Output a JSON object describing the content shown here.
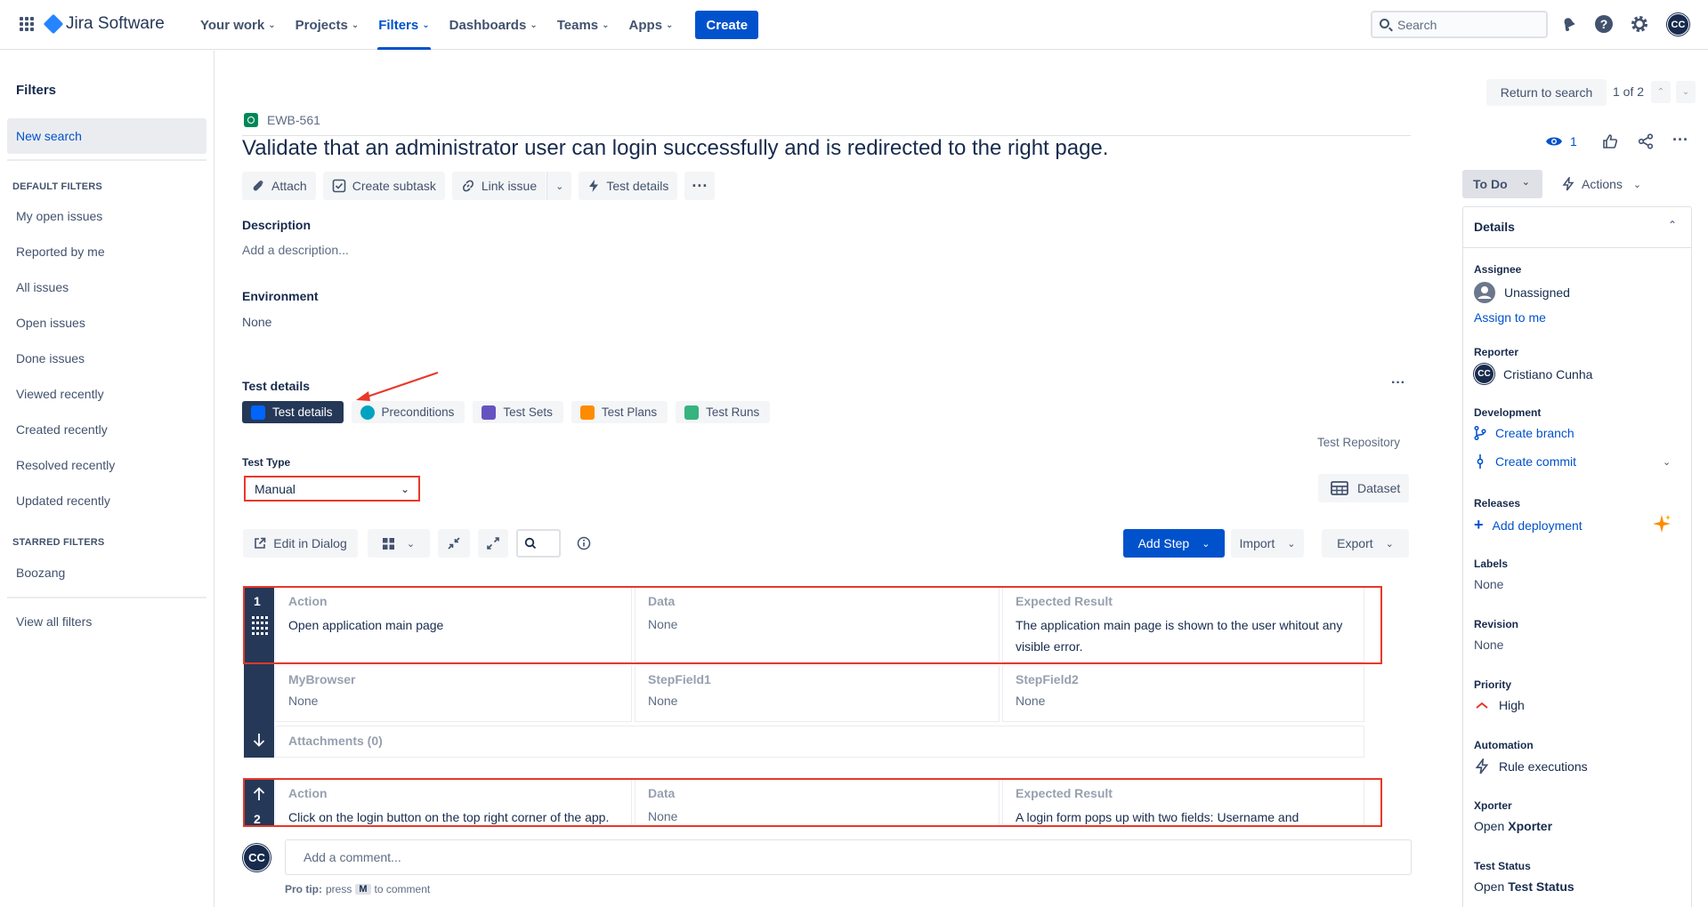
{
  "nav": {
    "product": "Jira Software",
    "items": [
      {
        "label": "Your work"
      },
      {
        "label": "Projects"
      },
      {
        "label": "Filters"
      },
      {
        "label": "Dashboards"
      },
      {
        "label": "Teams"
      },
      {
        "label": "Apps"
      }
    ],
    "create_label": "Create",
    "search_placeholder": "Search",
    "user_initials": "CC"
  },
  "sidebar": {
    "title": "Filters",
    "new_search": "New search",
    "default_heading": "DEFAULT FILTERS",
    "default_items": [
      "My open issues",
      "Reported by me",
      "All issues",
      "Open issues",
      "Done issues",
      "Viewed recently",
      "Created recently",
      "Resolved recently",
      "Updated recently"
    ],
    "starred_heading": "STARRED FILTERS",
    "starred_items": [
      "Boozang"
    ],
    "view_all": "View all filters"
  },
  "issue": {
    "key": "EWB-561",
    "title": "Validate that an administrator user can login successfully and is redirected to the right page.",
    "toolbar": {
      "attach": "Attach",
      "create_subtask": "Create subtask",
      "link_issue": "Link issue",
      "test_details": "Test details"
    },
    "description_label": "Description",
    "description_placeholder": "Add a description...",
    "environment_label": "Environment",
    "environment_value": "None"
  },
  "test_details": {
    "heading": "Test details",
    "tabs": [
      "Test details",
      "Preconditions",
      "Test Sets",
      "Test Plans",
      "Test Runs"
    ],
    "repository": "Test Repository",
    "type_label": "Test Type",
    "type_value": "Manual",
    "dataset": "Dataset",
    "edit_dialog": "Edit in Dialog",
    "add_step": "Add Step",
    "import": "Import",
    "export": "Export",
    "steps": [
      {
        "number": "1",
        "action_label": "Action",
        "action": "Open application main page",
        "data_label": "Data",
        "data": "None",
        "expected_label": "Expected Result",
        "expected": "The application main page is shown to the user whitout any visible error.",
        "custom": [
          {
            "label": "MyBrowser",
            "value": "None"
          },
          {
            "label": "StepField1",
            "value": "None"
          },
          {
            "label": "StepField2",
            "value": "None"
          }
        ],
        "attachments": "Attachments (0)"
      },
      {
        "number": "2",
        "action_label": "Action",
        "action": "Click on the login button on the top right corner of the app.",
        "data_label": "Data",
        "data": "None",
        "expected_label": "Expected Result",
        "expected": "A login form pops up with two fields: Username and"
      }
    ]
  },
  "comment": {
    "placeholder": "Add a comment...",
    "protip_prefix": "Pro tip:",
    "protip_press": "press",
    "protip_key": "M",
    "protip_suffix": "to comment"
  },
  "right": {
    "return_to_search": "Return to search",
    "pager": "1 of 2",
    "watch_count": "1",
    "status": "To Do",
    "actions": "Actions",
    "details_heading": "Details",
    "assignee_label": "Assignee",
    "assignee_value": "Unassigned",
    "assign_to_me": "Assign to me",
    "reporter_label": "Reporter",
    "reporter_value": "Cristiano Cunha",
    "reporter_initials": "CC",
    "development_label": "Development",
    "create_branch": "Create branch",
    "create_commit": "Create commit",
    "releases_label": "Releases",
    "add_deployment": "Add deployment",
    "labels_label": "Labels",
    "labels_value": "None",
    "revision_label": "Revision",
    "revision_value": "None",
    "priority_label": "Priority",
    "priority_value": "High",
    "automation_label": "Automation",
    "automation_value": "Rule executions",
    "xporter_label": "Xporter",
    "xporter_prefix": "Open",
    "xporter_name": "Xporter",
    "test_status_label": "Test Status",
    "test_status_prefix": "Open",
    "test_status_name": "Test Status"
  },
  "colors": {
    "brand": "#0052cc",
    "highlight": "#e8382a",
    "rail": "#253858"
  }
}
